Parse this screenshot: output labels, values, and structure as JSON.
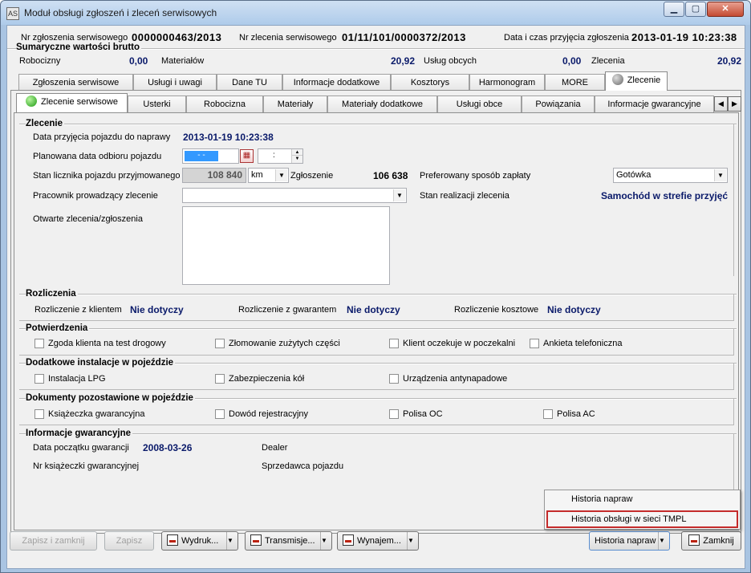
{
  "window": {
    "title": "Moduł obsługi zgłoszeń i zleceń serwisowych",
    "icon_text": "AS"
  },
  "header": {
    "nr_zgl_label": "Nr zgłoszenia serwisowego",
    "nr_zgl_value": "0000000463/2013",
    "nr_zlec_label": "Nr zlecenia serwisowego",
    "nr_zlec_value": "01/11/101/0000372/2013",
    "data_label": "Data i czas przyjęcia zgłoszenia",
    "data_value": "2013-01-19 10:23:38"
  },
  "summary": {
    "title": "Sumaryczne wartości brutto",
    "robocizny_label": "Robocizny",
    "robocizny_value": "0,00",
    "materialow_label": "Materiałów",
    "materialow_value": "20,92",
    "uslug_label": "Usług obcych",
    "uslug_value": "0,00",
    "zlecenia_label": "Zlecenia",
    "zlecenia_value": "20,92"
  },
  "main_tabs": [
    "Zgłoszenia serwisowe",
    "Usługi i uwagi",
    "Dane TU",
    "Informacje dodatkowe",
    "Kosztorys",
    "Harmonogram",
    "MORE",
    "Zlecenie"
  ],
  "sub_tabs": [
    "Zlecenie serwisowe",
    "Usterki",
    "Robocizna",
    "Materiały",
    "Materiały dodatkowe",
    "Usługi obce",
    "Powiązania",
    "Informacje gwarancyjne"
  ],
  "zlecenie": {
    "title": "Zlecenie",
    "data_przyjecia_label": "Data przyjęcia pojazdu do naprawy",
    "data_przyjecia_value": "2013-01-19 10:23:38",
    "planowana_label": "Planowana data odbioru pojazdu",
    "planowana_date_mask": "- -",
    "planowana_time_mask": ":",
    "licznik_label": "Stan licznika pojazdu przyjmowanego",
    "licznik_value": "108 840",
    "licznik_unit": "km",
    "zgloszenie_label": "Zgłoszenie",
    "zgloszenie_value": "106 638",
    "platnosc_label": "Preferowany sposób zapłaty",
    "platnosc_value": "Gotówka",
    "pracownik_label": "Pracownik prowadzący zlecenie",
    "pracownik_value": "",
    "stan_label": "Stan realizacji zlecenia",
    "stan_value": "Samochód w strefie przyjęć",
    "otwarte_label": "Otwarte zlecenia/zgłoszenia"
  },
  "rozliczenia": {
    "title": "Rozliczenia",
    "klient_label": "Rozliczenie z klientem",
    "klient_value": "Nie dotyczy",
    "gwarant_label": "Rozliczenie z gwarantem",
    "gwarant_value": "Nie dotyczy",
    "koszt_label": "Rozliczenie kosztowe",
    "koszt_value": "Nie dotyczy"
  },
  "potwierdzenia": {
    "title": "Potwierdzenia",
    "items": [
      "Zgoda klienta na test drogowy",
      "Złomowanie zużytych części",
      "Klient oczekuje w poczekalni",
      "Ankieta telefoniczna"
    ]
  },
  "instalacje": {
    "title": "Dodatkowe instalacje w pojeździe",
    "items": [
      "Instalacja LPG",
      "Zabezpieczenia kół",
      "Urządzenia antynapadowe"
    ]
  },
  "dokumenty": {
    "title": "Dokumenty pozostawione w pojeździe",
    "items": [
      "Książeczka gwarancyjna",
      "Dowód rejestracyjny",
      "Polisa OC",
      "Polisa AC"
    ]
  },
  "gwarancja": {
    "title": "Informacje gwarancyjne",
    "data_label": "Data początku gwarancji",
    "data_value": "2008-03-26",
    "dealer_label": "Dealer",
    "nr_label": "Nr książeczki gwarancyjnej",
    "sprzedawca_label": "Sprzedawca pojazdu"
  },
  "popup_menu": {
    "items": [
      "Historia napraw",
      "Historia obsługi w sieci TMPL"
    ]
  },
  "buttons": {
    "zapisz_zamknij": "Zapisz i zamknij",
    "zapisz": "Zapisz",
    "wydruk": "Wydruk...",
    "transmisje": "Transmisje...",
    "wynajem": "Wynajem...",
    "historia": "Historia napraw",
    "zamknij": "Zamknij"
  },
  "colors": {
    "value_blue": "#0a1a6a",
    "highlight_red": "#c42b2b",
    "selection_blue": "#3399ff"
  }
}
